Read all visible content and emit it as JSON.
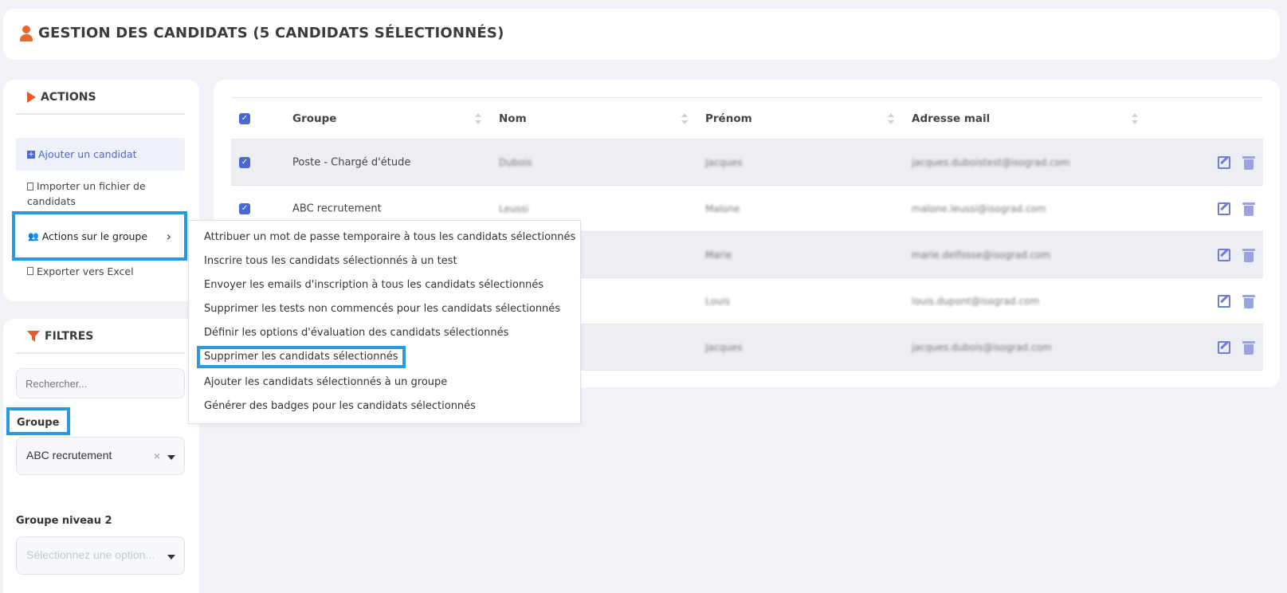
{
  "header": {
    "title": "GESTION DES CANDIDATS (5 CANDIDATS SÉLECTIONNÉS)"
  },
  "actions": {
    "title": "ACTIONS",
    "items": [
      {
        "label": "Ajouter un candidat",
        "icon": "plus-square-icon"
      },
      {
        "label": "Importer un fichier de candidats",
        "icon": "file-import-icon"
      },
      {
        "label": "Actions sur le groupe",
        "icon": "users-icon"
      },
      {
        "label": "Exporter vers Excel",
        "icon": "excel-file-icon"
      }
    ]
  },
  "filters": {
    "title": "FILTRES",
    "search_placeholder": "Rechercher...",
    "groupe_label": "Groupe",
    "groupe_value": "ABC recrutement",
    "groupe_niveau2_label": "Groupe niveau 2",
    "groupe_niveau2_placeholder": "Sélectionnez une option..."
  },
  "table": {
    "columns": [
      "Groupe",
      "Nom",
      "Prénom",
      "Adresse mail"
    ],
    "rows": [
      {
        "groupe": "Poste - Chargé d'étude",
        "nom": "Dubois",
        "prenom": "Jacques",
        "mail": "jacques.duboistest@isograd.com"
      },
      {
        "groupe": "ABC recrutement",
        "nom": "Leussi",
        "prenom": "Malone",
        "mail": "malone.leussi@isograd.com"
      },
      {
        "groupe": "",
        "nom": "",
        "prenom": "Marie",
        "mail": "marie.delfosse@isograd.com"
      },
      {
        "groupe": "",
        "nom": "",
        "prenom": "Louis",
        "mail": "louis.dupont@isograd.com"
      },
      {
        "groupe": "",
        "nom": "",
        "prenom": "Jacques",
        "mail": "jacques.dubois@isograd.com"
      }
    ]
  },
  "group_menu": {
    "items": [
      "Attribuer un mot de passe temporaire à tous les candidats sélectionnés",
      "Inscrire tous les candidats sélectionnés à un test",
      "Envoyer les emails d'inscription à tous les candidats sélectionnés",
      "Supprimer les tests non commencés pour les candidats sélectionnés",
      "Définir les options d'évaluation des candidats sélectionnés",
      "Supprimer les candidats sélectionnés",
      "Ajouter les candidats sélectionnés à un groupe",
      "Générer des badges pour les candidats sélectionnés"
    ]
  },
  "colors": {
    "accent": "#4a67d6",
    "brand_orange": "#e85a2a",
    "highlight": "#2b99de"
  }
}
